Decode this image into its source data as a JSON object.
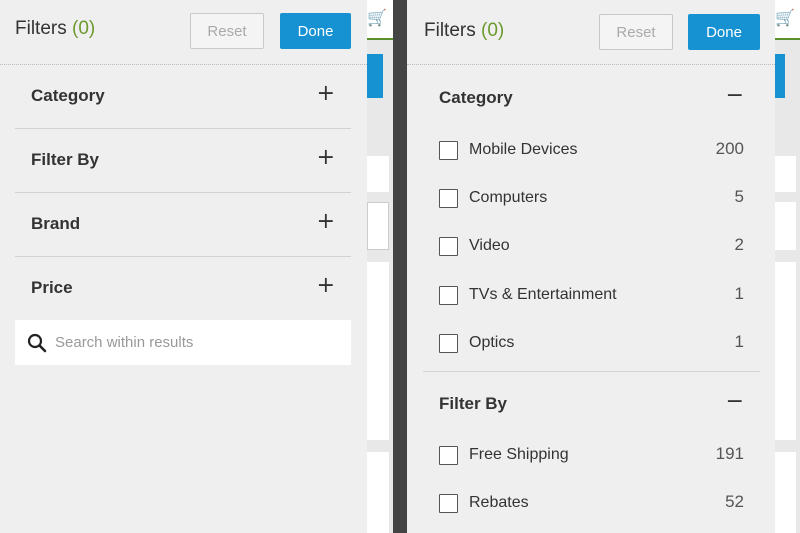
{
  "left_panel": {
    "title": "Filters",
    "count": "(0)",
    "reset_label": "Reset",
    "done_label": "Done",
    "sections": [
      {
        "label": "Category",
        "toggle": "+"
      },
      {
        "label": "Filter By",
        "toggle": "+"
      },
      {
        "label": "Brand",
        "toggle": "+"
      },
      {
        "label": "Price",
        "toggle": "+"
      }
    ],
    "search": {
      "placeholder": "Search within results",
      "icon": "search-icon"
    }
  },
  "right_panel": {
    "title": "Filters",
    "count": "(0)",
    "reset_label": "Reset",
    "done_label": "Done",
    "category": {
      "label": "Category",
      "toggle": "−",
      "options": [
        {
          "label": "Mobile Devices",
          "count": "200",
          "checked": false
        },
        {
          "label": "Computers",
          "count": "5",
          "checked": false
        },
        {
          "label": "Video",
          "count": "2",
          "checked": false
        },
        {
          "label": "TVs & Entertainment",
          "count": "1",
          "checked": false
        },
        {
          "label": "Optics",
          "count": "1",
          "checked": false
        }
      ]
    },
    "filter_by": {
      "label": "Filter By",
      "toggle": "−",
      "options": [
        {
          "label": "Free Shipping",
          "count": "191",
          "checked": false
        },
        {
          "label": "Rebates",
          "count": "52",
          "checked": false
        }
      ]
    }
  },
  "colors": {
    "accent": "#1691d1",
    "count_green": "#6b9a2e",
    "panel_bg": "#efefef",
    "gutter": "#444444"
  }
}
